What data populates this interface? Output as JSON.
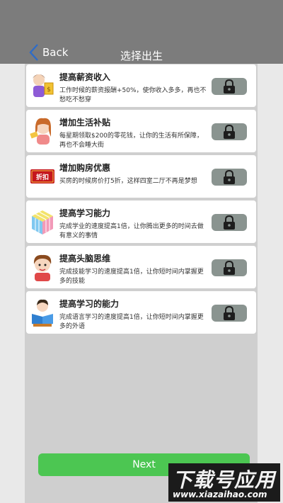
{
  "header": {
    "back_label": "Back",
    "title": "选择出生"
  },
  "items": [
    {
      "title": "提高薪资收入",
      "desc": "工作时候的薪资报酬+50%，使你收入多多，再也不愁吃不愁穿",
      "icon": "salary-person-icon"
    },
    {
      "title": "增加生活补贴",
      "desc": "每星期领取$200的零花钱，让你的生活有所保障，再也不会睡大街",
      "icon": "allowance-girl-icon"
    },
    {
      "title": "增加购房优惠",
      "desc": "买房的时候房价打5折，这样四室二厅不再是梦想",
      "icon": "discount-tag-icon"
    },
    {
      "title": "提高学习能力",
      "desc": "完成学业的速度提高1倍，让你腾出更多的时间去做有意义的事情",
      "icon": "rubiks-cube-icon"
    },
    {
      "title": "提高头脑思维",
      "desc": "完成技能学习的速度提高1倍，让你短时间内掌握更多的技能",
      "icon": "thinking-child-icon"
    },
    {
      "title": "提高学习的能力",
      "desc": "完成语言学习的速度提高1倍，让你短时间内掌握更多的外语",
      "icon": "reading-child-icon"
    }
  ],
  "discount_tag_text": "折扣",
  "next_label": "Next",
  "watermark": {
    "line1": "下载号应用",
    "line2": "www.xiazaihao.com"
  },
  "colors": {
    "header": "#7c7c7c",
    "next": "#4cc652",
    "lock_button": "#8a9490"
  }
}
